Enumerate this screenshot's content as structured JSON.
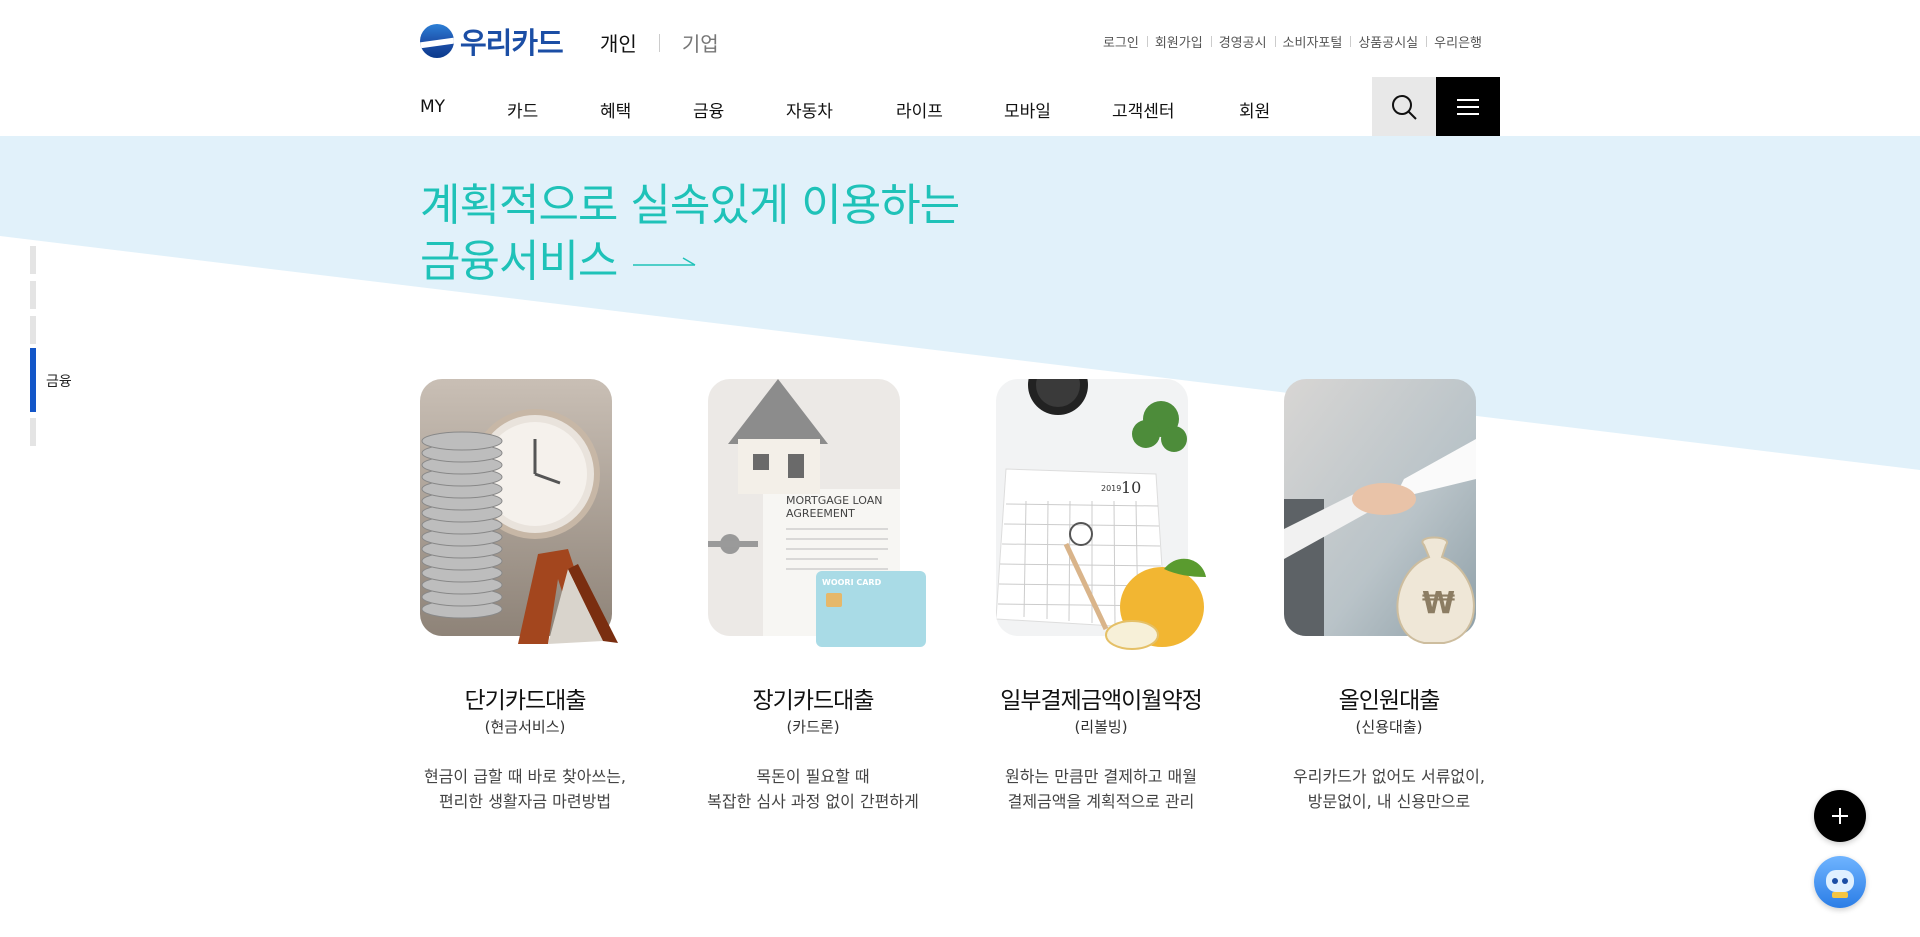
{
  "header": {
    "logo_text": "우리카드",
    "segments": {
      "personal": "개인",
      "corporate": "기업"
    },
    "utility_links": [
      "로그인",
      "회원가입",
      "경영공시",
      "소비자포털",
      "상품공시실",
      "우리은행"
    ],
    "nav": [
      "MY",
      "카드",
      "혜택",
      "금융",
      "자동차",
      "라이프",
      "모바일",
      "고객센터",
      "회원"
    ],
    "search_icon": "search-icon",
    "menu_icon": "hamburger-menu-icon"
  },
  "hero": {
    "headline_line1": "계획적으로 실속있게 이용하는",
    "headline_line2": "금융서비스",
    "colors": {
      "accent": "#1fc2b8",
      "background": "#e1f1fa",
      "indicator_active": "#1356c8"
    }
  },
  "side_indicator": {
    "active_label": "금융"
  },
  "cards": [
    {
      "title": "단기카드대출",
      "subtitle": "(현금서비스)",
      "desc_line1": "현금이 급할 때 바로 찾아쓰는,",
      "desc_line2": "편리한 생활자금 마련방법"
    },
    {
      "title": "장기카드대출",
      "subtitle": "(카드론)",
      "desc_line1": "목돈이 필요할 때",
      "desc_line2": "복잡한 심사 과정 없이 간편하게"
    },
    {
      "title": "일부결제금액이월약정",
      "subtitle": "(리볼빙)",
      "desc_line1": "원하는 만큼만 결제하고 매월",
      "desc_line2": "결제금액을 계획적으로 관리"
    },
    {
      "title": "올인원대출",
      "subtitle": "(신용대출)",
      "desc_line1": "우리카드가 없어도 서류없이,",
      "desc_line2": "방문없이, 내 신용만으로"
    }
  ],
  "card_image_texts": {
    "mortgage_line1": "MORTGAGE LOAN",
    "mortgage_line2": "AGREEMENT",
    "card_brand": "WOORI CARD",
    "calendar_year": "2019",
    "calendar_month": "10",
    "money_bag_symbol": "₩"
  },
  "floating": {
    "plus_icon": "plus-icon",
    "chatbot_icon": "chatbot-icon"
  }
}
